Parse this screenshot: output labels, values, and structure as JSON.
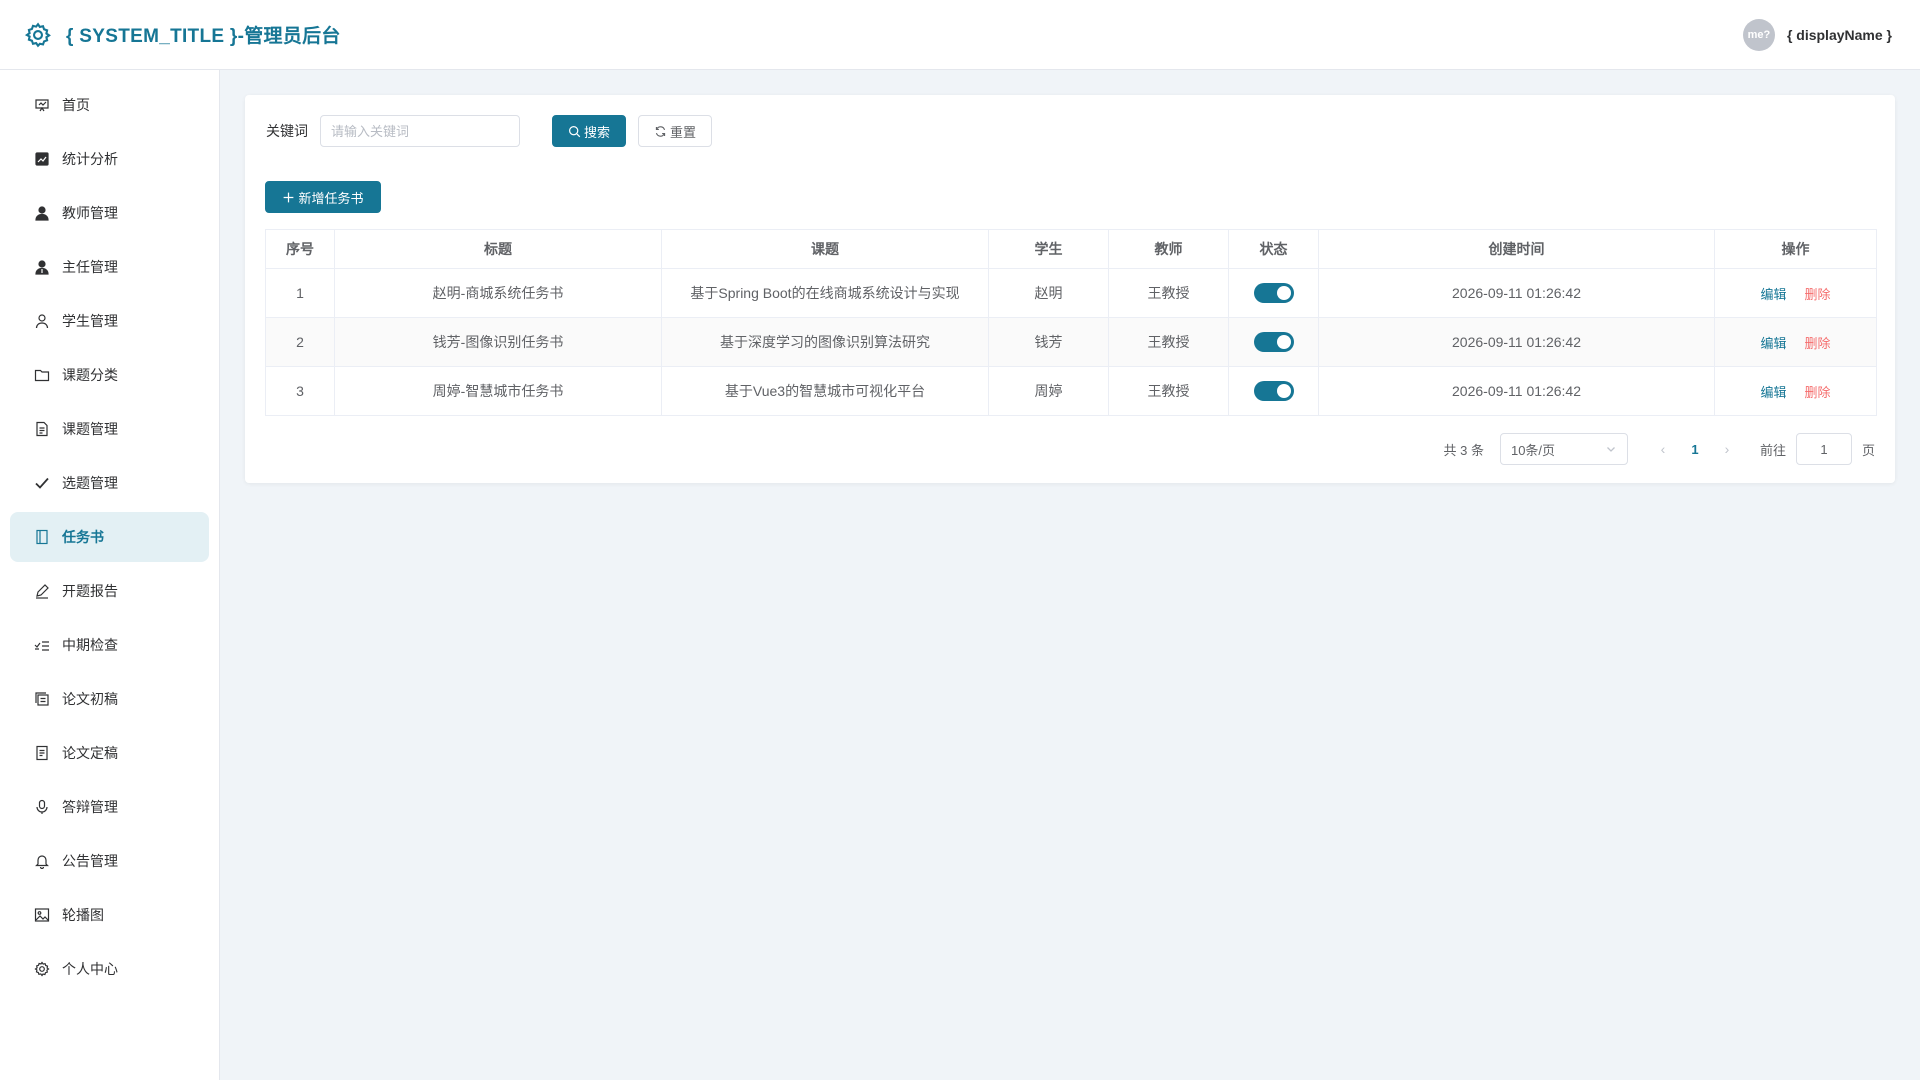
{
  "header": {
    "title": "{ SYSTEM_TITLE }-管理员后台",
    "avatar_text": "me?",
    "display_name": "{ displayName }"
  },
  "sidebar": {
    "items": [
      {
        "label": "首页",
        "icon": "dashboard-icon"
      },
      {
        "label": "统计分析",
        "icon": "chart-icon"
      },
      {
        "label": "教师管理",
        "icon": "user-filled-icon"
      },
      {
        "label": "主任管理",
        "icon": "user-tie-icon"
      },
      {
        "label": "学生管理",
        "icon": "user-outline-icon"
      },
      {
        "label": "课题分类",
        "icon": "folder-icon"
      },
      {
        "label": "课题管理",
        "icon": "document-icon"
      },
      {
        "label": "选题管理",
        "icon": "check-icon"
      },
      {
        "label": "任务书",
        "icon": "notebook-icon",
        "active": true
      },
      {
        "label": "开题报告",
        "icon": "edit-pen-icon"
      },
      {
        "label": "中期检查",
        "icon": "checklist-icon"
      },
      {
        "label": "论文初稿",
        "icon": "copy-document-icon"
      },
      {
        "label": "论文定稿",
        "icon": "tickets-icon"
      },
      {
        "label": "答辩管理",
        "icon": "microphone-icon"
      },
      {
        "label": "公告管理",
        "icon": "bell-icon"
      },
      {
        "label": "轮播图",
        "icon": "picture-icon"
      },
      {
        "label": "个人中心",
        "icon": "setting-icon"
      }
    ]
  },
  "search": {
    "label": "关键词",
    "placeholder": "请输入关键词",
    "value": "",
    "search_button": "搜索",
    "reset_button": "重置"
  },
  "toolbar": {
    "add_button": "新增任务书"
  },
  "table": {
    "columns": [
      "序号",
      "标题",
      "课题",
      "学生",
      "教师",
      "状态",
      "创建时间",
      "操作"
    ],
    "rows": [
      {
        "index": "1",
        "title": "赵明-商城系统任务书",
        "topic": "基于Spring Boot的在线商城系统设计与实现",
        "student": "赵明",
        "teacher": "王教授",
        "status": true,
        "created": "2026-09-11 01:26:42",
        "edit": "编辑",
        "delete": "删除"
      },
      {
        "index": "2",
        "title": "钱芳-图像识别任务书",
        "topic": "基于深度学习的图像识别算法研究",
        "student": "钱芳",
        "teacher": "王教授",
        "status": true,
        "created": "2026-09-11 01:26:42",
        "edit": "编辑",
        "delete": "删除"
      },
      {
        "index": "3",
        "title": "周婷-智慧城市任务书",
        "topic": "基于Vue3的智慧城市可视化平台",
        "student": "周婷",
        "teacher": "王教授",
        "status": true,
        "created": "2026-09-11 01:26:42",
        "edit": "编辑",
        "delete": "删除"
      }
    ]
  },
  "pagination": {
    "total_text": "共 3 条",
    "page_size": "10条/页",
    "current_page": "1",
    "goto_label": "前往",
    "goto_value": "1",
    "goto_suffix": "页"
  },
  "colors": {
    "primary": "#167695",
    "danger": "#f56c6c",
    "active_menu_bg": "#e3f0f4"
  }
}
